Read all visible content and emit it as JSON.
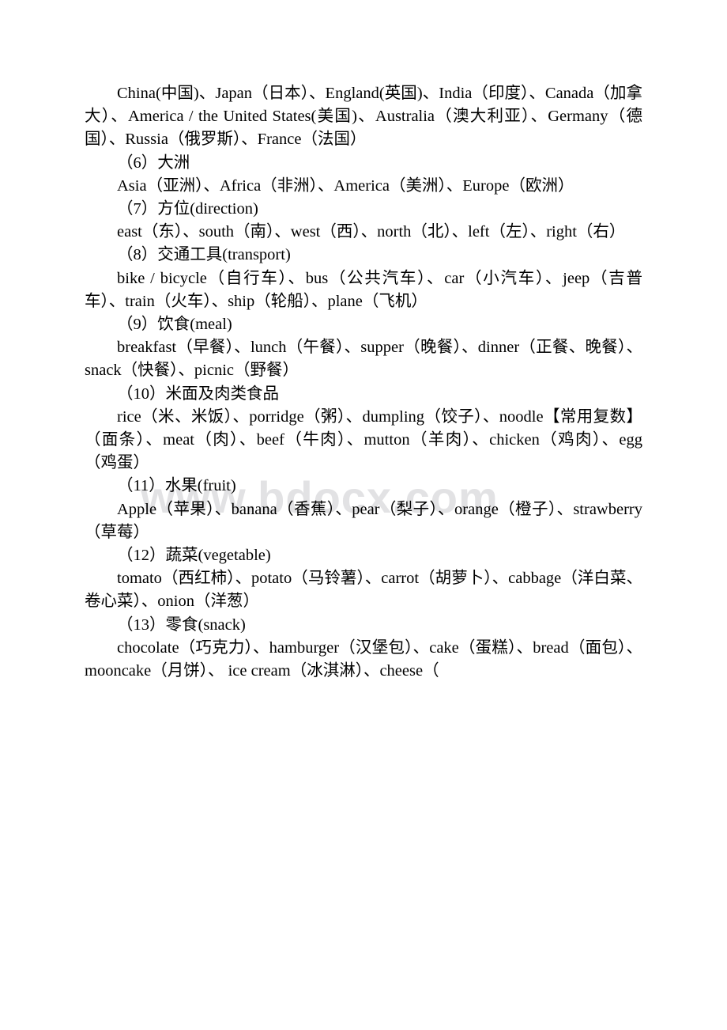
{
  "document": {
    "watermark": "www.bdocx.com",
    "blocks": [
      {
        "id": "countries-list",
        "type": "body",
        "text": "China(中国)、Japan（日本）、England(英国)、India（印度）、Canada（加拿大）、America / the United States(美国)、Australia（澳大利亚）、Germany（德国）、Russia（俄罗斯）、France（法国）"
      },
      {
        "id": "heading-6-continents",
        "type": "heading",
        "text": "（6）大洲"
      },
      {
        "id": "continents-list",
        "type": "body",
        "text": "Asia（亚洲）、Africa（非洲）、America（美洲）、Europe（欧洲）"
      },
      {
        "id": "heading-7-direction",
        "type": "heading",
        "text": "（7）方位(direction)"
      },
      {
        "id": "directions-list",
        "type": "body",
        "text": "east（东）、south（南）、west（西）、north（北）、left（左）、right（右）"
      },
      {
        "id": "heading-8-transport",
        "type": "heading",
        "text": "（8）交通工具(transport)"
      },
      {
        "id": "transport-list",
        "type": "body",
        "text": "bike / bicycle（自行车）、bus（公共汽车）、car（小汽车）、jeep（吉普车）、train（火车）、ship（轮船）、plane（飞机）"
      },
      {
        "id": "heading-9-meal",
        "type": "heading",
        "text": "（9）饮食(meal)"
      },
      {
        "id": "meals-list",
        "type": "body",
        "text": "breakfast（早餐）、lunch（午餐）、supper（晚餐）、dinner（正餐、晚餐）、snack（快餐）、picnic（野餐）"
      },
      {
        "id": "heading-10-staples-meat",
        "type": "heading",
        "text": "（10）米面及肉类食品"
      },
      {
        "id": "staples-meat-list",
        "type": "body",
        "text": "rice（米、米饭）、porridge（粥）、dumpling（饺子）、noodle【常用复数】（面条）、meat（肉）、beef（牛肉）、mutton（羊肉）、chicken（鸡肉）、egg（鸡蛋）"
      },
      {
        "id": "heading-11-fruit",
        "type": "heading",
        "text": "（11）水果(fruit)"
      },
      {
        "id": "fruits-list",
        "type": "body",
        "text": "Apple（苹果）、banana（香蕉）、pear（梨子）、orange（橙子）、strawberry（草莓）"
      },
      {
        "id": "heading-12-vegetable",
        "type": "heading",
        "text": "（12）蔬菜(vegetable)"
      },
      {
        "id": "vegetables-list",
        "type": "body",
        "text": "tomato（西红柿）、potato（马铃薯）、carrot（胡萝卜）、cabbage（洋白菜、卷心菜）、onion（洋葱）"
      },
      {
        "id": "heading-13-snack",
        "type": "heading",
        "text": "（13）零食(snack)"
      },
      {
        "id": "snacks-list",
        "type": "body",
        "text": "chocolate（巧克力）、hamburger（汉堡包）、cake（蛋糕）、bread（面包）、mooncake（月饼）、 ice cream（冰淇淋）、cheese（"
      }
    ]
  }
}
